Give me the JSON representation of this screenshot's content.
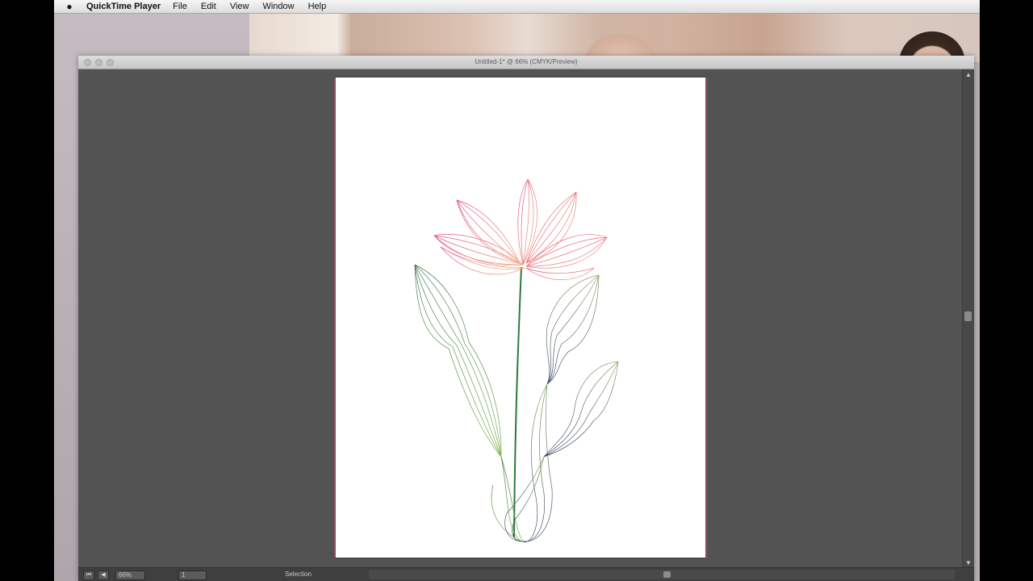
{
  "menubar": {
    "apple_icon": "apple-logo-icon",
    "app_name": "QuickTime Player",
    "items": [
      "File",
      "Edit",
      "View",
      "Window",
      "Help"
    ]
  },
  "document": {
    "title": "Untitled-1* @ 66% (CMYK/Preview)",
    "statusbar": {
      "zoom": "66%",
      "page": "1",
      "tool": "Selection"
    }
  },
  "colors": {
    "petal": "#e8507a",
    "petal_light": "#f19bb0",
    "stem": "#2e7d3a",
    "leaf_green": "#6aa04a",
    "leaf_dark": "#4a5070"
  }
}
